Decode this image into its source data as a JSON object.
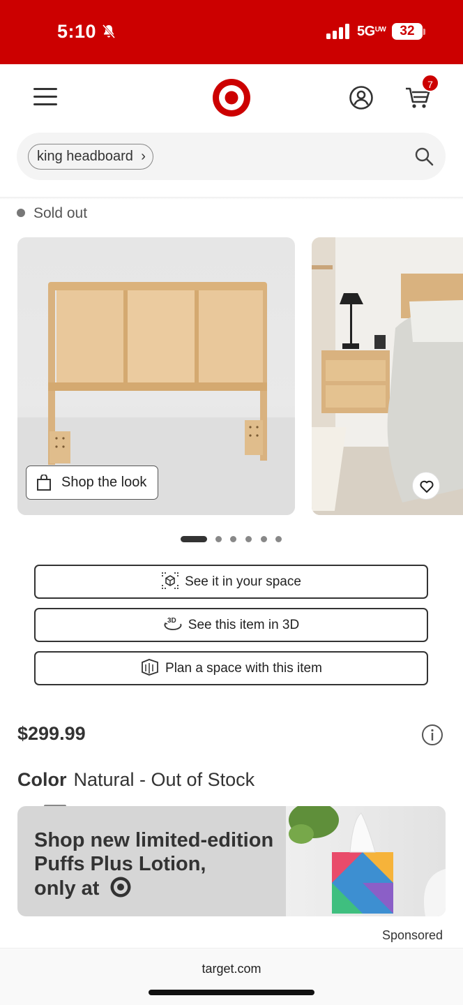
{
  "status_bar": {
    "time": "5:10",
    "network": "5G",
    "network_sub": "UW",
    "battery": "32"
  },
  "header": {
    "menu_icon": "hamburger-menu-icon",
    "logo": "target-bullseye-logo",
    "account_icon": "account-icon",
    "cart_icon": "cart-icon",
    "cart_count": "7",
    "brand_color": "#cc0000"
  },
  "search": {
    "query_chip": "king headboard",
    "chip_chevron": "›",
    "search_icon": "search-icon"
  },
  "product": {
    "availability": "Sold out",
    "shop_the_look_label": "Shop the look",
    "carousel": {
      "total_images": 6,
      "active_index": 0
    },
    "actions": [
      {
        "label": "See it in your space",
        "icon": "ar-cube-icon"
      },
      {
        "label": "See this item in 3D",
        "icon": "3d-rotate-icon"
      },
      {
        "label": "Plan a space with this item",
        "icon": "room-plan-icon"
      }
    ],
    "price": "$299.99",
    "color_label": "Color",
    "color_value": "Natural - Out of Stock"
  },
  "ad": {
    "line1": "Shop new limited-edition",
    "line2": "Puffs Plus Lotion,",
    "line3": "only at",
    "sponsored_label": "Sponsored"
  },
  "browser": {
    "url": "target.com"
  }
}
